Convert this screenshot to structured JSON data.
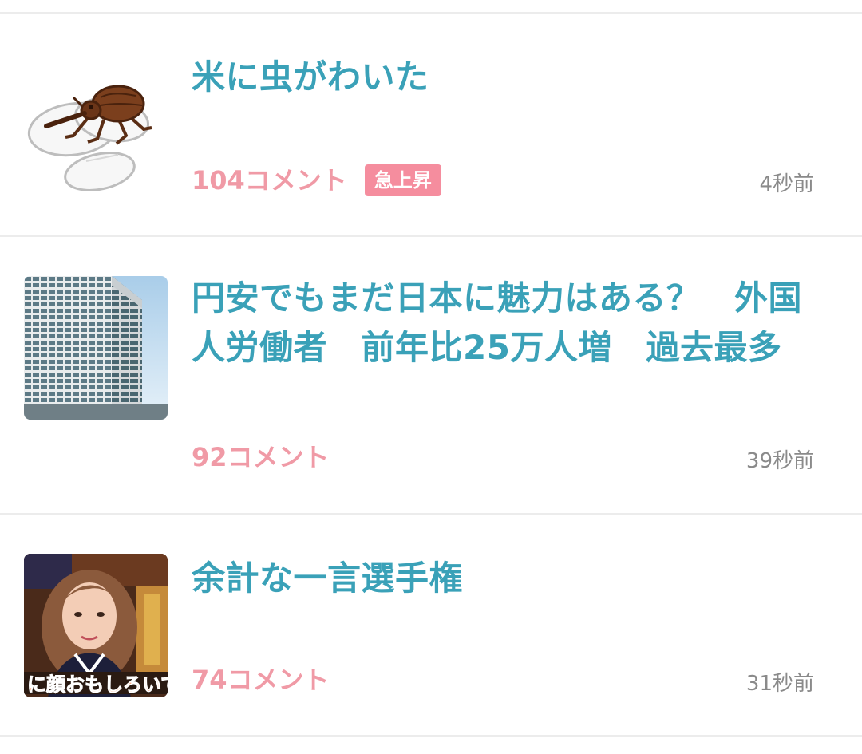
{
  "feed": {
    "items": [
      {
        "title": "米に虫がわいた",
        "comments": "104コメント",
        "badge": "急上昇",
        "time": "4秒前",
        "thumbnail": "rice-weevil-illustration"
      },
      {
        "title": "円安でもまだ日本に魅力はある？　外国人労働者　前年比25万人増　過去最多",
        "comments": "92コメント",
        "time": "39秒前",
        "thumbnail": "office-building-photo"
      },
      {
        "title": "余計な一言選手権",
        "comments": "74コメント",
        "time": "31秒前",
        "thumbnail": "tv-show-woman-photo",
        "thumbnail_caption": "に顔おもしろいで"
      }
    ]
  },
  "colors": {
    "title": "#3aa1b8",
    "comments": "#f09aa6",
    "badge_bg": "#f58d9e",
    "time": "#8a8a8a",
    "divider": "#ececec"
  }
}
